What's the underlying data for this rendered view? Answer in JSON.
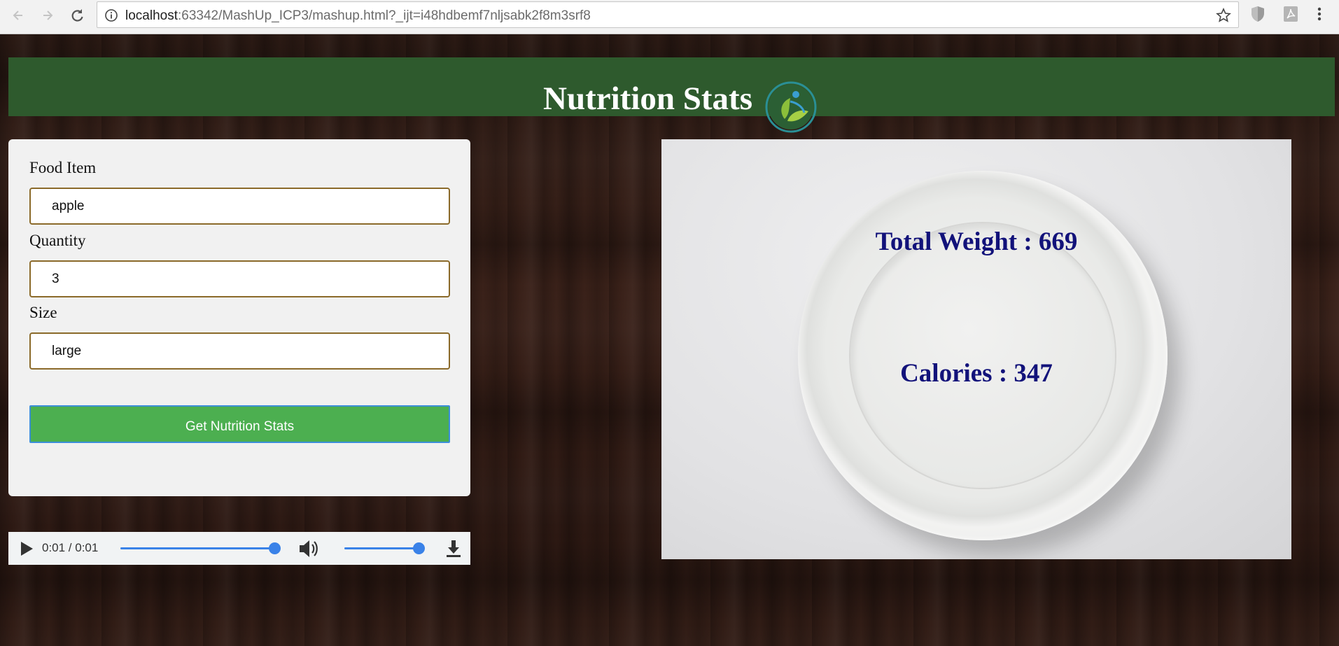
{
  "browser": {
    "url_host": "localhost",
    "url_rest": ":63342/MashUp_ICP3/mashup.html?_ijt=i48hdbemf7nljsabk2f8m3srf8"
  },
  "header": {
    "title": "Nutrition Stats"
  },
  "form": {
    "food_label": "Food Item",
    "food_value": "apple",
    "quantity_label": "Quantity",
    "quantity_value": "3",
    "size_label": "Size",
    "size_value": "large",
    "submit_label": "Get Nutrition Stats"
  },
  "audio": {
    "time": "0:01 / 0:01",
    "progress": 1.0,
    "volume": 1.0
  },
  "results": {
    "weight_text": "Total Weight : 669",
    "calories_text": "Calories : 347"
  },
  "colors": {
    "banner": "#2e5a2d",
    "button": "#4caf50",
    "stat_text": "#12127a",
    "accent": "#3a82e8"
  }
}
